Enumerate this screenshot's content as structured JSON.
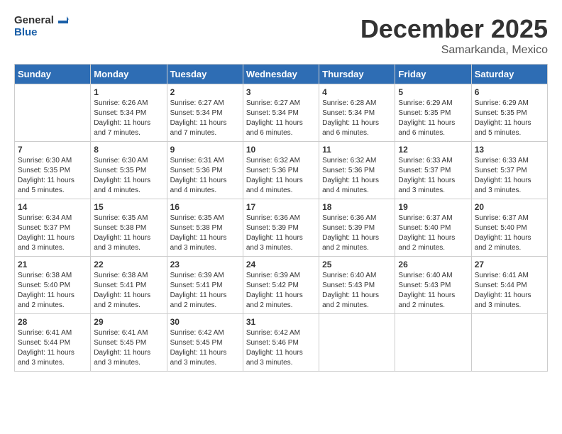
{
  "header": {
    "logo_line1": "General",
    "logo_line2": "Blue",
    "month": "December 2025",
    "location": "Samarkanda, Mexico"
  },
  "weekdays": [
    "Sunday",
    "Monday",
    "Tuesday",
    "Wednesday",
    "Thursday",
    "Friday",
    "Saturday"
  ],
  "weeks": [
    [
      {
        "day": "",
        "info": ""
      },
      {
        "day": "1",
        "info": "Sunrise: 6:26 AM\nSunset: 5:34 PM\nDaylight: 11 hours\nand 7 minutes."
      },
      {
        "day": "2",
        "info": "Sunrise: 6:27 AM\nSunset: 5:34 PM\nDaylight: 11 hours\nand 7 minutes."
      },
      {
        "day": "3",
        "info": "Sunrise: 6:27 AM\nSunset: 5:34 PM\nDaylight: 11 hours\nand 6 minutes."
      },
      {
        "day": "4",
        "info": "Sunrise: 6:28 AM\nSunset: 5:34 PM\nDaylight: 11 hours\nand 6 minutes."
      },
      {
        "day": "5",
        "info": "Sunrise: 6:29 AM\nSunset: 5:35 PM\nDaylight: 11 hours\nand 6 minutes."
      },
      {
        "day": "6",
        "info": "Sunrise: 6:29 AM\nSunset: 5:35 PM\nDaylight: 11 hours\nand 5 minutes."
      }
    ],
    [
      {
        "day": "7",
        "info": "Sunrise: 6:30 AM\nSunset: 5:35 PM\nDaylight: 11 hours\nand 5 minutes."
      },
      {
        "day": "8",
        "info": "Sunrise: 6:30 AM\nSunset: 5:35 PM\nDaylight: 11 hours\nand 4 minutes."
      },
      {
        "day": "9",
        "info": "Sunrise: 6:31 AM\nSunset: 5:36 PM\nDaylight: 11 hours\nand 4 minutes."
      },
      {
        "day": "10",
        "info": "Sunrise: 6:32 AM\nSunset: 5:36 PM\nDaylight: 11 hours\nand 4 minutes."
      },
      {
        "day": "11",
        "info": "Sunrise: 6:32 AM\nSunset: 5:36 PM\nDaylight: 11 hours\nand 4 minutes."
      },
      {
        "day": "12",
        "info": "Sunrise: 6:33 AM\nSunset: 5:37 PM\nDaylight: 11 hours\nand 3 minutes."
      },
      {
        "day": "13",
        "info": "Sunrise: 6:33 AM\nSunset: 5:37 PM\nDaylight: 11 hours\nand 3 minutes."
      }
    ],
    [
      {
        "day": "14",
        "info": "Sunrise: 6:34 AM\nSunset: 5:37 PM\nDaylight: 11 hours\nand 3 minutes."
      },
      {
        "day": "15",
        "info": "Sunrise: 6:35 AM\nSunset: 5:38 PM\nDaylight: 11 hours\nand 3 minutes."
      },
      {
        "day": "16",
        "info": "Sunrise: 6:35 AM\nSunset: 5:38 PM\nDaylight: 11 hours\nand 3 minutes."
      },
      {
        "day": "17",
        "info": "Sunrise: 6:36 AM\nSunset: 5:39 PM\nDaylight: 11 hours\nand 3 minutes."
      },
      {
        "day": "18",
        "info": "Sunrise: 6:36 AM\nSunset: 5:39 PM\nDaylight: 11 hours\nand 2 minutes."
      },
      {
        "day": "19",
        "info": "Sunrise: 6:37 AM\nSunset: 5:40 PM\nDaylight: 11 hours\nand 2 minutes."
      },
      {
        "day": "20",
        "info": "Sunrise: 6:37 AM\nSunset: 5:40 PM\nDaylight: 11 hours\nand 2 minutes."
      }
    ],
    [
      {
        "day": "21",
        "info": "Sunrise: 6:38 AM\nSunset: 5:40 PM\nDaylight: 11 hours\nand 2 minutes."
      },
      {
        "day": "22",
        "info": "Sunrise: 6:38 AM\nSunset: 5:41 PM\nDaylight: 11 hours\nand 2 minutes."
      },
      {
        "day": "23",
        "info": "Sunrise: 6:39 AM\nSunset: 5:41 PM\nDaylight: 11 hours\nand 2 minutes."
      },
      {
        "day": "24",
        "info": "Sunrise: 6:39 AM\nSunset: 5:42 PM\nDaylight: 11 hours\nand 2 minutes."
      },
      {
        "day": "25",
        "info": "Sunrise: 6:40 AM\nSunset: 5:43 PM\nDaylight: 11 hours\nand 2 minutes."
      },
      {
        "day": "26",
        "info": "Sunrise: 6:40 AM\nSunset: 5:43 PM\nDaylight: 11 hours\nand 2 minutes."
      },
      {
        "day": "27",
        "info": "Sunrise: 6:41 AM\nSunset: 5:44 PM\nDaylight: 11 hours\nand 3 minutes."
      }
    ],
    [
      {
        "day": "28",
        "info": "Sunrise: 6:41 AM\nSunset: 5:44 PM\nDaylight: 11 hours\nand 3 minutes."
      },
      {
        "day": "29",
        "info": "Sunrise: 6:41 AM\nSunset: 5:45 PM\nDaylight: 11 hours\nand 3 minutes."
      },
      {
        "day": "30",
        "info": "Sunrise: 6:42 AM\nSunset: 5:45 PM\nDaylight: 11 hours\nand 3 minutes."
      },
      {
        "day": "31",
        "info": "Sunrise: 6:42 AM\nSunset: 5:46 PM\nDaylight: 11 hours\nand 3 minutes."
      },
      {
        "day": "",
        "info": ""
      },
      {
        "day": "",
        "info": ""
      },
      {
        "day": "",
        "info": ""
      }
    ]
  ]
}
